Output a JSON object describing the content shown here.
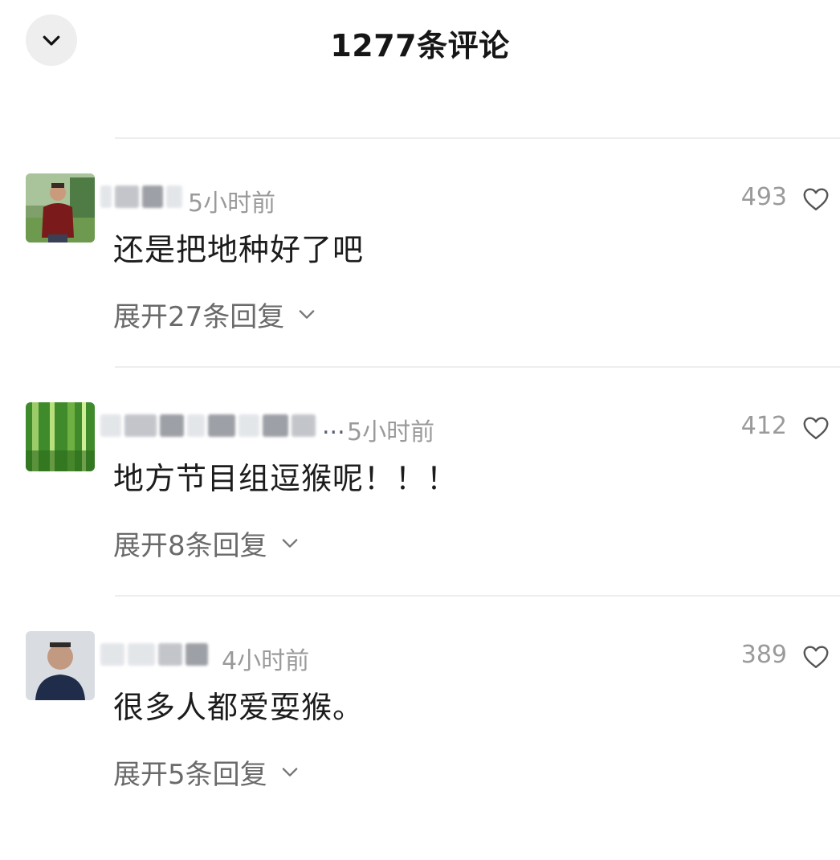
{
  "header": {
    "title": "1277条评论"
  },
  "comments": [
    {
      "time": "5小时前",
      "likes": "493",
      "text": "还是把地种好了吧",
      "expand_label": "展开27条回复"
    },
    {
      "time": "5小时前",
      "username_suffix": "...",
      "likes": "412",
      "text": "地方节目组逗猴呢！！！",
      "expand_label": "展开8条回复"
    },
    {
      "time": "4小时前",
      "likes": "389",
      "text": "很多人都爱耍猴。",
      "expand_label": "展开5条回复"
    }
  ],
  "icons": {
    "collapse": "chevron-down-icon",
    "like": "heart-outline-icon",
    "expand": "chevron-down-icon"
  },
  "colors": {
    "text_primary": "#1c1c1c",
    "text_secondary": "#9a9a9a",
    "expand_text": "#6a6a6a",
    "divider": "#eeeeee"
  }
}
